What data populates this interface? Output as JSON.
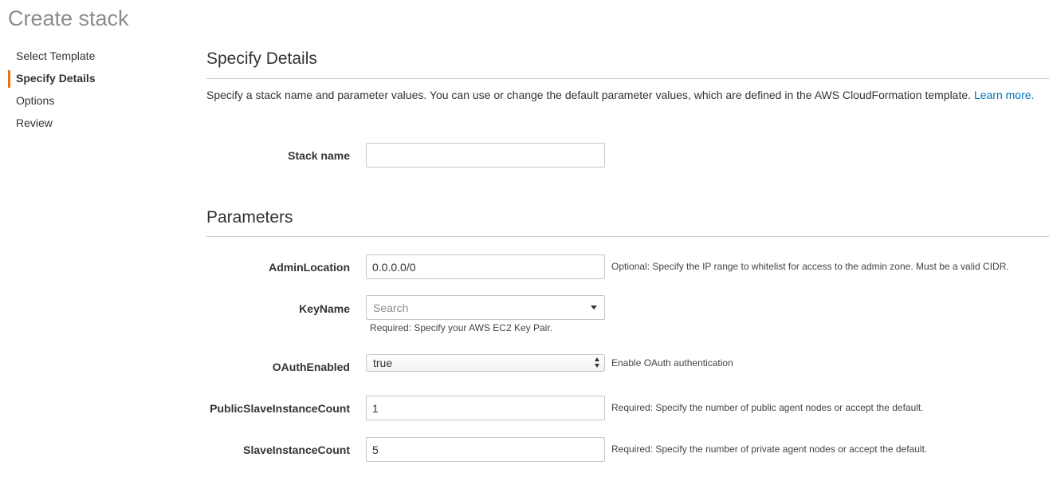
{
  "page": {
    "title": "Create stack"
  },
  "wizard": {
    "steps": [
      {
        "label": "Select Template",
        "active": false
      },
      {
        "label": "Specify Details",
        "active": true
      },
      {
        "label": "Options",
        "active": false
      },
      {
        "label": "Review",
        "active": false
      }
    ]
  },
  "details": {
    "title": "Specify Details",
    "intro": "Specify a stack name and parameter values. You can use or change the default parameter values, which are defined in the AWS CloudFormation template.",
    "learn_more": "Learn more.",
    "stack_name_label": "Stack name",
    "stack_name_value": ""
  },
  "parameters": {
    "title": "Parameters",
    "admin_location": {
      "label": "AdminLocation",
      "value": "0.0.0.0/0",
      "help": "Optional: Specify the IP range to whitelist for access to the admin zone. Must be a valid CIDR."
    },
    "key_name": {
      "label": "KeyName",
      "placeholder": "Search",
      "help": "Required: Specify your AWS EC2 Key Pair."
    },
    "oauth_enabled": {
      "label": "OAuthEnabled",
      "value": "true",
      "help": "Enable OAuth authentication"
    },
    "public_slave_count": {
      "label": "PublicSlaveInstanceCount",
      "value": "1",
      "help": "Required: Specify the number of public agent nodes or accept the default."
    },
    "slave_count": {
      "label": "SlaveInstanceCount",
      "value": "5",
      "help": "Required: Specify the number of private agent nodes or accept the default."
    }
  },
  "colors": {
    "accent": "#ec7211",
    "link": "#0073bb",
    "title_gray": "#8c8c8c"
  }
}
